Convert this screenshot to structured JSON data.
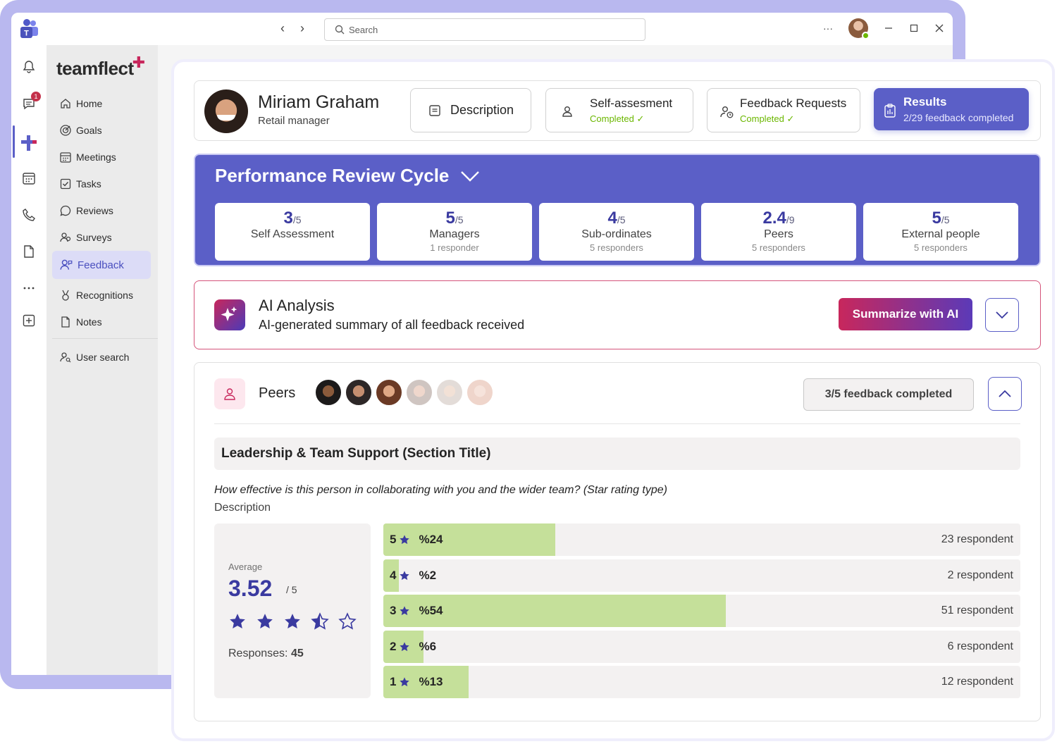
{
  "titlebar": {
    "search_placeholder": "Search",
    "more_label": "···"
  },
  "rail": {
    "chat_badge": "1"
  },
  "sidebar": {
    "brand": "teamflect",
    "items": [
      {
        "label": "Home",
        "icon": "home-icon"
      },
      {
        "label": "Goals",
        "icon": "target-icon"
      },
      {
        "label": "Meetings",
        "icon": "calendar-icon"
      },
      {
        "label": "Tasks",
        "icon": "checkbox-icon"
      },
      {
        "label": "Reviews",
        "icon": "chat-icon"
      },
      {
        "label": "Surveys",
        "icon": "people-icon"
      },
      {
        "label": "Feedback",
        "icon": "people-feedback-icon",
        "active": true
      },
      {
        "label": "Recognitions",
        "icon": "medal-icon"
      },
      {
        "label": "Notes",
        "icon": "document-icon"
      },
      {
        "label": "User search",
        "icon": "person-search-icon"
      }
    ]
  },
  "profile": {
    "name": "Miriam Graham",
    "role": "Retail manager"
  },
  "tabs": {
    "description": {
      "title": "Description"
    },
    "self": {
      "title": "Self-assesment",
      "status": "Completed ✓"
    },
    "requests": {
      "title": "Feedback Requests",
      "status": "Completed ✓"
    },
    "results": {
      "title": "Results",
      "status": "2/29 feedback completed"
    }
  },
  "cycle": {
    "title": "Performance Review Cycle",
    "scores": [
      {
        "value": "3",
        "max": "/5",
        "label": "Self Assessment",
        "sub": ""
      },
      {
        "value": "5",
        "max": "/5",
        "label": "Managers",
        "sub": "1 responder"
      },
      {
        "value": "4",
        "max": "/5",
        "label": "Sub-ordinates",
        "sub": "5 responders"
      },
      {
        "value": "2.4",
        "max": "/9",
        "label": "Peers",
        "sub": "5 responders"
      },
      {
        "value": "5",
        "max": "/5",
        "label": "External people",
        "sub": "5 responders"
      }
    ]
  },
  "ai": {
    "title": "AI Analysis",
    "subtitle": "AI-generated summary of all feedback received",
    "button": "Summarize with AI"
  },
  "peers": {
    "title": "Peers",
    "completed": "3/5 feedback completed",
    "section_title": "Leadership & Team Support (Section Title)",
    "question": "How effective is this person in collaborating with you and the wider team? (Star rating type)",
    "description": "Description",
    "average": {
      "label": "Average",
      "value": "3.52",
      "of": "/ 5",
      "responses_label": "Responses:",
      "responses": "45",
      "rating": 3.52
    },
    "bars": [
      {
        "star": "5",
        "pct": "%24",
        "fill": 0.27,
        "count": "23 respondent"
      },
      {
        "star": "4",
        "pct": "%2",
        "fill": 0.024,
        "count": "2 respondent"
      },
      {
        "star": "3",
        "pct": "%54",
        "fill": 0.538,
        "count": "51 respondent"
      },
      {
        "star": "2",
        "pct": "%6",
        "fill": 0.063,
        "count": "6 respondent"
      },
      {
        "star": "1",
        "pct": "%13",
        "fill": 0.134,
        "count": "12 respondent"
      }
    ]
  },
  "colors": {
    "accent": "#5b5fc7",
    "bar_fill": "#c5e09a",
    "completed": "#6bb700",
    "ai_gradient_start": "#c8275c"
  }
}
